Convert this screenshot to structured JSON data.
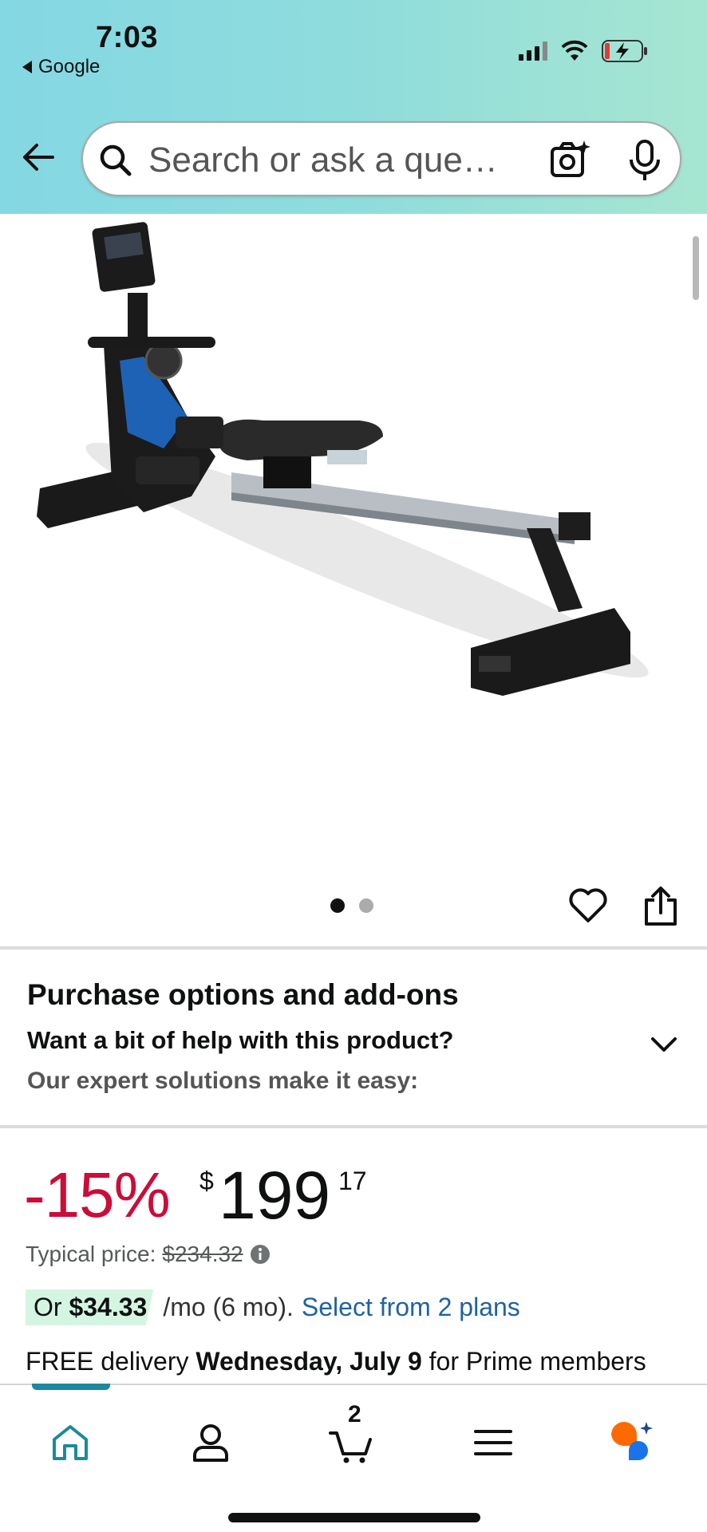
{
  "status_bar": {
    "time": "7:03",
    "back_app": "Google"
  },
  "search": {
    "placeholder": "Search or ask a que…"
  },
  "carousel": {
    "image_count": 2,
    "active_index": 0
  },
  "purchase_options": {
    "title": "Purchase options and add-ons",
    "subtitle": "Want a bit of help with this product?",
    "note": "Our expert solutions make it easy:"
  },
  "price": {
    "discount": "-15%",
    "currency": "$",
    "whole": "199",
    "fraction": "17",
    "typical_label": "Typical price:",
    "typical_value": "$234.32"
  },
  "installment": {
    "prefix": "Or",
    "amount": "$34.33",
    "rest": "/mo (6 mo).",
    "link": "Select from 2 plans"
  },
  "delivery": {
    "prefix": "FREE delivery",
    "date": "Wednesday, July 9",
    "suffix": "for Prime members"
  },
  "nav": {
    "cart_count": "2",
    "active": "home"
  },
  "colors": {
    "discount": "#cc0c39",
    "link": "#2162a1",
    "nav_accent": "#1b8a9c",
    "installment_bg": "#d5f5e3"
  }
}
